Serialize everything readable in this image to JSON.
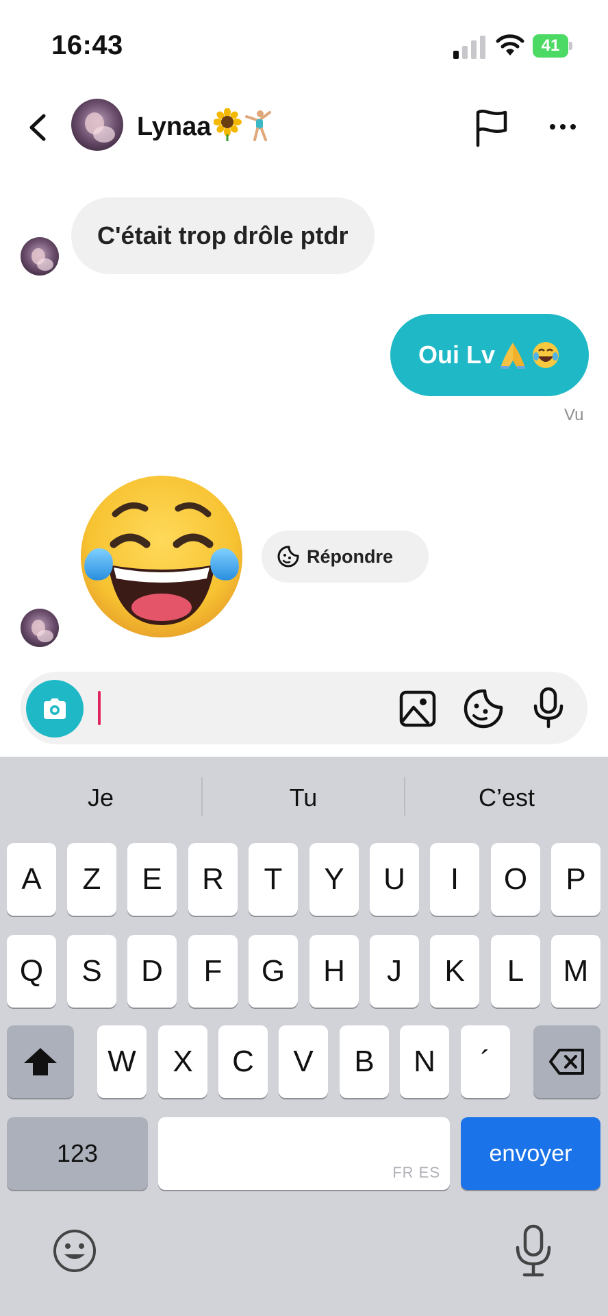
{
  "status_bar": {
    "time": "16:43",
    "battery": "41"
  },
  "header": {
    "contact_name": "Lynaa",
    "name_emojis": [
      "sunflower",
      "cartwheeling-person"
    ]
  },
  "messages": {
    "incoming_1": "C'était trop drôle ptdr",
    "outgoing_1": "Oui Lv",
    "outgoing_emojis": [
      "folded-hands",
      "tears-of-joy"
    ],
    "seen_label": "Vu",
    "big_emoji": "face-with-tears-of-joy",
    "reply_label": "Répondre"
  },
  "composer": {
    "input_value": ""
  },
  "keyboard": {
    "suggestions": [
      "Je",
      "Tu",
      "C’est"
    ],
    "row1": [
      "A",
      "Z",
      "E",
      "R",
      "T",
      "Y",
      "U",
      "I",
      "O",
      "P"
    ],
    "row2": [
      "Q",
      "S",
      "D",
      "F",
      "G",
      "H",
      "J",
      "K",
      "L",
      "M"
    ],
    "row3": [
      "W",
      "X",
      "C",
      "V",
      "B",
      "N",
      "´"
    ],
    "numbers_label": "123",
    "space_lang": "FR ES",
    "send_label": "envoyer"
  },
  "colors": {
    "accent": "#1fb8c6",
    "send_key": "#1a73e8",
    "caret": "#e0245e"
  }
}
